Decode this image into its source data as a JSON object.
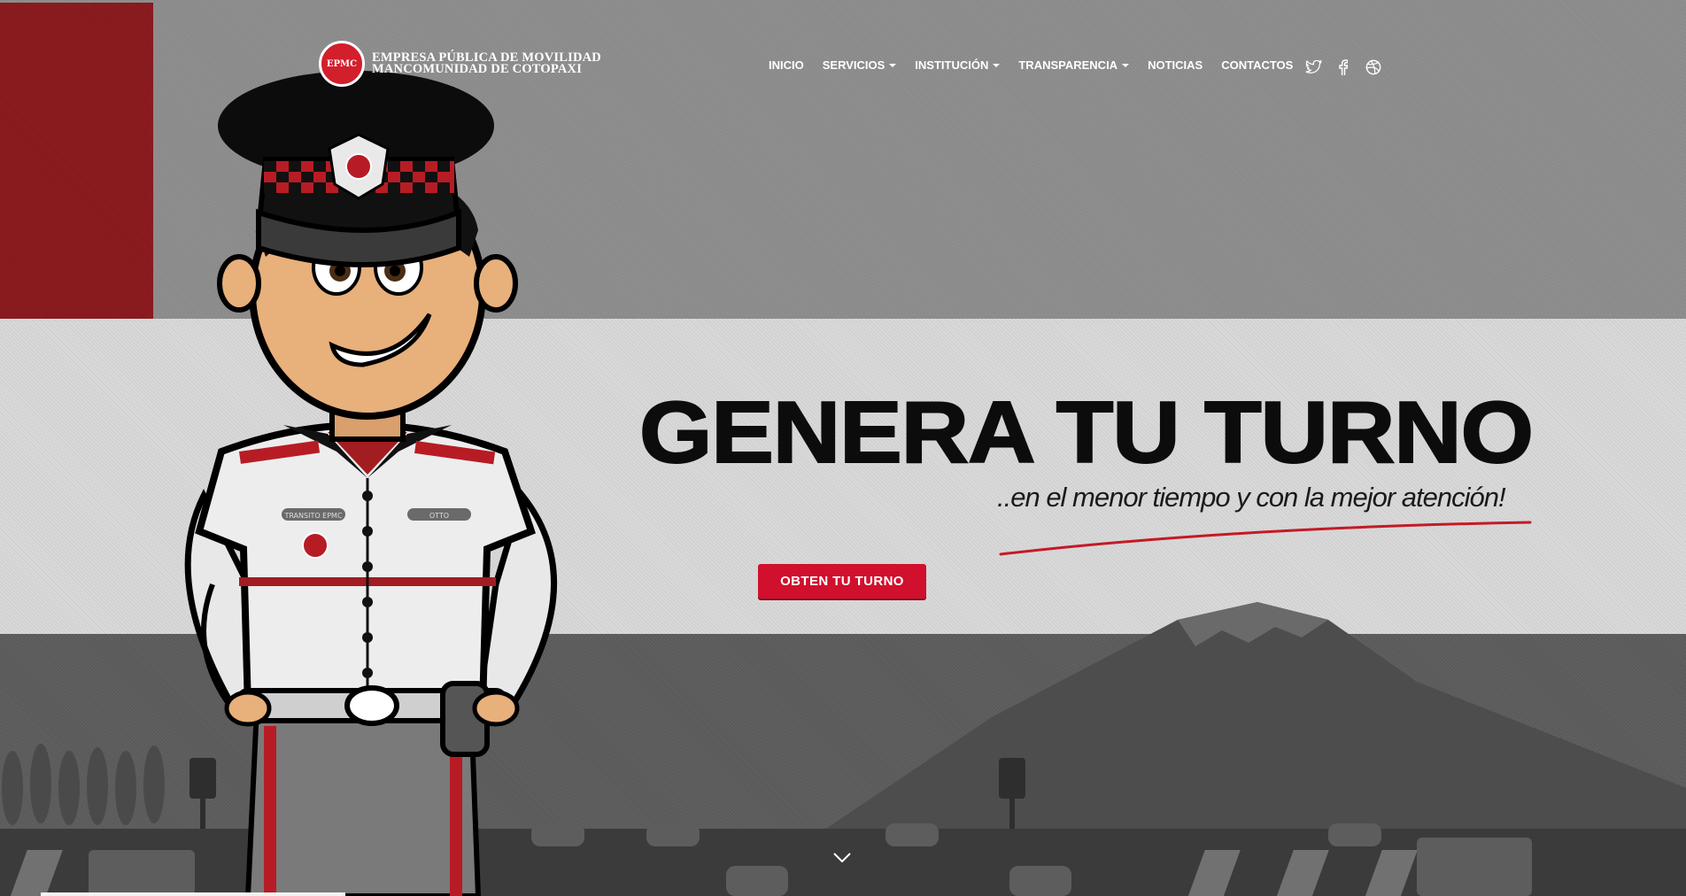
{
  "brand": {
    "badge_text": "EPMC",
    "line1": "EMPRESA PÚBLICA DE MOVILIDAD",
    "line2": "MANCOMUNIDAD DE COTOPAXI"
  },
  "nav": {
    "items": [
      {
        "label": "INICIO",
        "dropdown": false
      },
      {
        "label": "SERVICIOS",
        "dropdown": true
      },
      {
        "label": "INSTITUCIÓN",
        "dropdown": true
      },
      {
        "label": "TRANSPARENCIA",
        "dropdown": true
      },
      {
        "label": "NOTICIAS",
        "dropdown": false
      },
      {
        "label": "CONTACTOS",
        "dropdown": false
      }
    ]
  },
  "social": {
    "icons": [
      "twitter-icon",
      "facebook-icon",
      "dribbble-icon"
    ]
  },
  "hero": {
    "headline": "GENERA TU TURNO",
    "subline": "..en el menor tiempo y con la mejor atención!",
    "cta_label": "OBTEN TU TURNO"
  },
  "officer": {
    "name_tag_left": "TRANSITO EPMC",
    "name_tag_right": "OTTO"
  },
  "colors": {
    "accent_red": "#d0102d",
    "dark_red": "#8c1b1f",
    "white": "#ffffff"
  }
}
